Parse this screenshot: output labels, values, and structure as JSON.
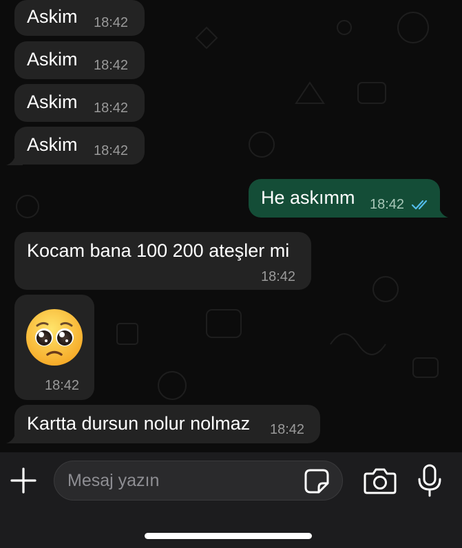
{
  "messages": [
    {
      "direction": "incoming",
      "text": "Askim",
      "time": "18:42"
    },
    {
      "direction": "incoming",
      "text": "Askim",
      "time": "18:42"
    },
    {
      "direction": "incoming",
      "text": "Askim",
      "time": "18:42"
    },
    {
      "direction": "incoming",
      "text": "Askim",
      "time": "18:42"
    },
    {
      "direction": "outgoing",
      "text": "He askımm",
      "time": "18:42",
      "status_icon": "double-check-icon",
      "status": "read"
    },
    {
      "direction": "incoming",
      "text": "Kocam bana 100 200 ateşler mi",
      "time": "18:42"
    },
    {
      "direction": "incoming",
      "emoji": "pleading-face",
      "time": "18:42"
    },
    {
      "direction": "incoming",
      "text": "Kartta dursun nolur nolmaz",
      "time": "18:42"
    }
  ],
  "composer": {
    "placeholder": "Mesaj yazın",
    "icons": [
      "plus-icon",
      "sticker-icon",
      "camera-icon",
      "mic-icon"
    ]
  },
  "colors": {
    "background": "#0c0c0c",
    "incoming_bubble": "#232323",
    "outgoing_bubble": "#144d37",
    "read_ticks": "#53bdeb",
    "composer_bar": "#1c1c1e"
  }
}
